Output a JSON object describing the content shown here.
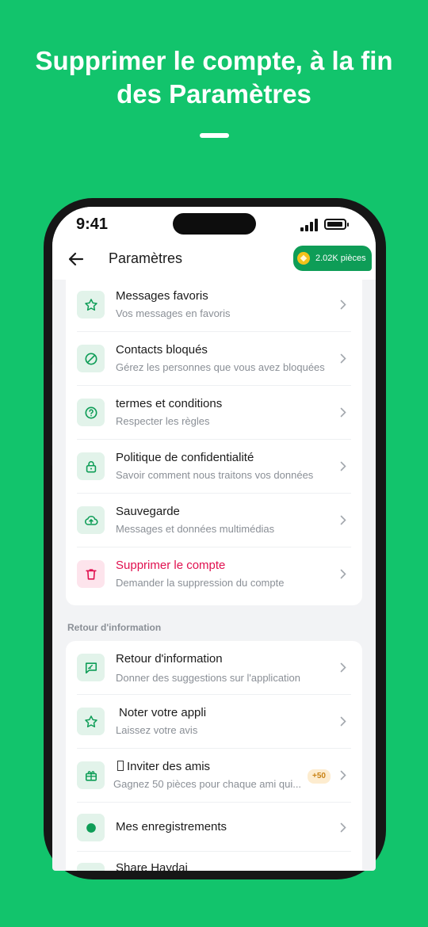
{
  "headline": {
    "line1": "Supprimer le compte, à la fin",
    "line2": "des Paramètres"
  },
  "status_bar": {
    "time": "9:41"
  },
  "header": {
    "title": "Paramètres",
    "coins_label": "2.02K pièces"
  },
  "settings_group": {
    "items": [
      {
        "title": "Messages favoris",
        "subtitle": "Vos messages en favoris",
        "icon": "star-icon"
      },
      {
        "title": "Contacts bloqués",
        "subtitle": "Gérez les personnes que vous avez bloquées",
        "icon": "block-icon"
      },
      {
        "title": "termes et conditions",
        "subtitle": "Respecter les règles",
        "icon": "help-circle-icon"
      },
      {
        "title": "Politique de confidentialité",
        "subtitle": "Savoir comment nous traitons vos données",
        "icon": "lock-icon"
      },
      {
        "title": "Sauvegarde",
        "subtitle": "Messages et données multimédias",
        "icon": "cloud-upload-icon"
      },
      {
        "title": "Supprimer le compte",
        "subtitle": "Demander la suppression du compte",
        "icon": "trash-icon"
      }
    ]
  },
  "feedback_group": {
    "label": "Retour d'information",
    "items": [
      {
        "title": "Retour d'information",
        "subtitle": "Donner des suggestions sur l'application",
        "icon": "feedback-icon"
      },
      {
        "title": "Noter votre appli",
        "subtitle": "Laissez votre avis",
        "icon": "star-icon"
      },
      {
        "title": "Inviter des amis",
        "subtitle": "Gagnez 50 pièces pour chaque ami qui...",
        "icon": "gift-icon",
        "badge": "+50"
      },
      {
        "title": "Mes enregistrements",
        "subtitle": "",
        "icon": "record-icon"
      },
      {
        "title": "Share Haydai",
        "subtitle": "",
        "icon": "share-icon"
      }
    ]
  },
  "colors": {
    "background": "#12c46c",
    "accent": "#0e9d57",
    "danger": "#e0104f",
    "coin": "#f2c21b"
  }
}
